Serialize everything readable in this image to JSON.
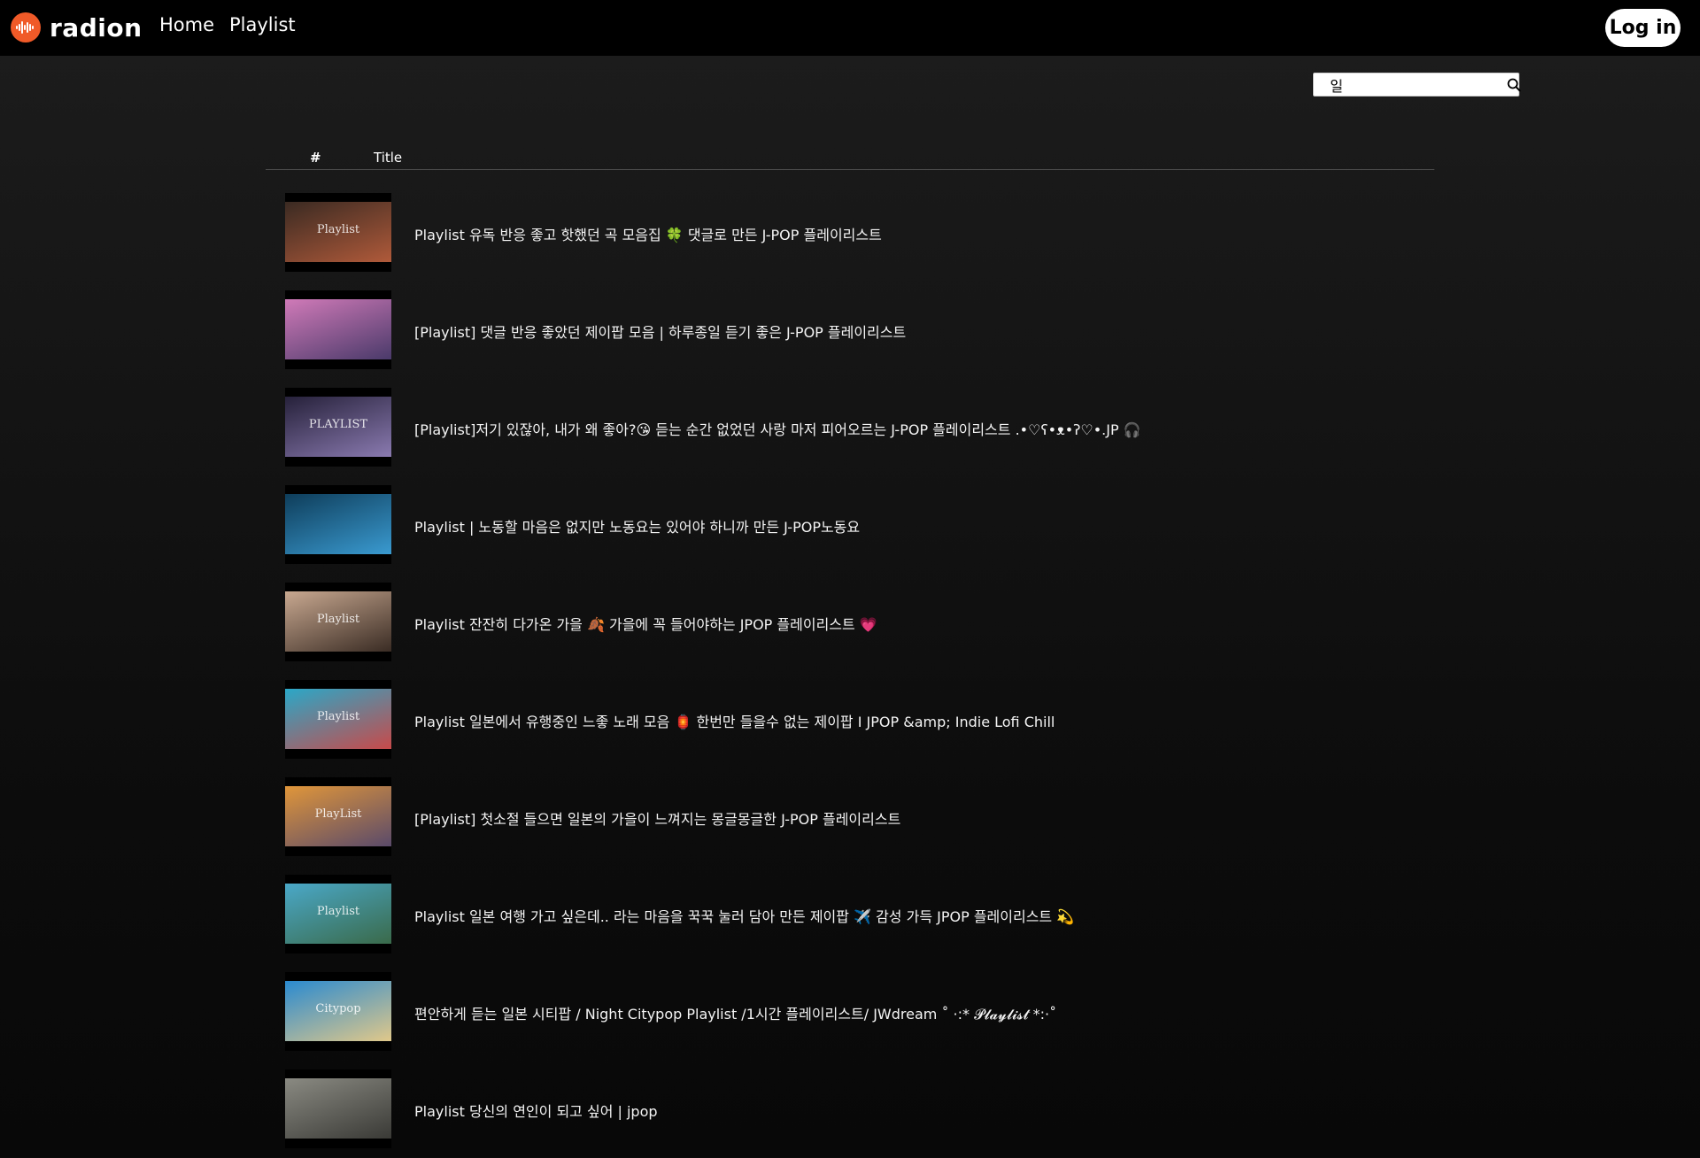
{
  "header": {
    "brand_name": "radion",
    "nav": [
      {
        "label": "Home"
      },
      {
        "label": "Playlist"
      }
    ],
    "login_label": "Log in"
  },
  "search": {
    "value": "일",
    "icon": "search-icon"
  },
  "list": {
    "columns": {
      "number": "#",
      "title": "Title"
    },
    "items": [
      {
        "title": "Playlist 유독 반응 좋고 핫했던 곡 모음집 🍀 댓글로 만든 J-POP 플레이리스트",
        "thumb_colors": [
          "#3a2a22",
          "#b05a3a"
        ],
        "thumb_caption": "Playlist"
      },
      {
        "title": "[Playlist] 댓글 반응 좋았던 제이팝 모음 | 하루종일 듣기 좋은 J-POP 플레이리스트",
        "thumb_colors": [
          "#d07ab8",
          "#4a3a6a"
        ],
        "thumb_caption": ""
      },
      {
        "title": "[Playlist]저기 있잖아, 내가 왜 좋아?😘 듣는 순간 없었던 사랑 마저 피어오르는 J-POP 플레이리스트 .•♡ʕ•ᴥ•ʔ♡•.JP 🎧",
        "thumb_colors": [
          "#26213a",
          "#8a7ab0"
        ],
        "thumb_caption": "PLAYLIST"
      },
      {
        "title": "Playlist | 노동할 마음은 없지만 노동요는 있어야 하니까 만든 J-POP노동요",
        "thumb_colors": [
          "#0e3d5a",
          "#3a9ad0"
        ],
        "thumb_caption": ""
      },
      {
        "title": "Playlist 잔잔히 다가온 가을 🍂 가을에 꼭 들어야하는 JPOP 플레이리스트 💗",
        "thumb_colors": [
          "#c8a890",
          "#3a2c24"
        ],
        "thumb_caption": "Playlist"
      },
      {
        "title": "Playlist 일본에서 유행중인 느좋 노래 모음 🏮 한번만 들을수 없는 제이팝 I JPOP &amp; Indie Lofi Chill",
        "thumb_colors": [
          "#2aa8c8",
          "#c84a4a"
        ],
        "thumb_caption": "Playlist"
      },
      {
        "title": "[Playlist] 첫소절 들으면 일본의 가을이 느껴지는 몽글몽글한 J-POP 플레이리스트",
        "thumb_colors": [
          "#e0963a",
          "#5a4a6a"
        ],
        "thumb_caption": "PlayList"
      },
      {
        "title": "Playlist 일본 여행 가고 싶은데.. 라는 마음을 꾹꾹 눌러 담아 만든 제이팝 ✈️ 감성 가득 JPOP 플레이리스트 💫",
        "thumb_colors": [
          "#4aa8c8",
          "#3a6a4a"
        ],
        "thumb_caption": "Playlist"
      },
      {
        "title": "편안하게 듣는 일본 시티팝 / Night Citypop Playlist /1시간 플레이리스트/ JWdream ˚ ·:* 𝓟𝓵𝓪𝔂𝓵𝓲𝓼𝓽 *:·˚",
        "thumb_colors": [
          "#2a8ad0",
          "#e0c88a"
        ],
        "thumb_caption": "Citypop"
      },
      {
        "title": "Playlist 당신의 연인이 되고 싶어 | jpop",
        "thumb_colors": [
          "#8a8a82",
          "#3a3a36"
        ],
        "thumb_caption": ""
      }
    ]
  },
  "colors": {
    "brand_accent": "#f05a28",
    "header_bg": "#000000",
    "page_bg": "#141414"
  }
}
